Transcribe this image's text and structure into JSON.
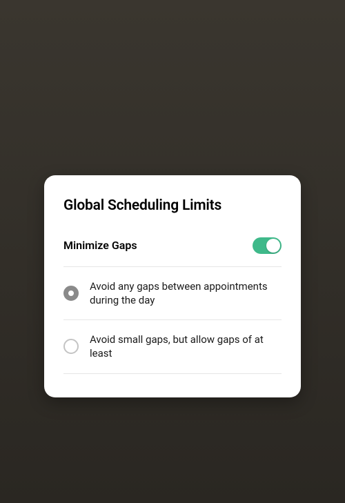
{
  "card": {
    "title": "Global Scheduling Limits",
    "toggle": {
      "label": "Minimize Gaps",
      "on": true
    },
    "options": [
      {
        "label": "Avoid any gaps between appointments during the day",
        "selected": true
      },
      {
        "label": "Avoid small gaps, but allow gaps of at least",
        "selected": false
      }
    ]
  }
}
